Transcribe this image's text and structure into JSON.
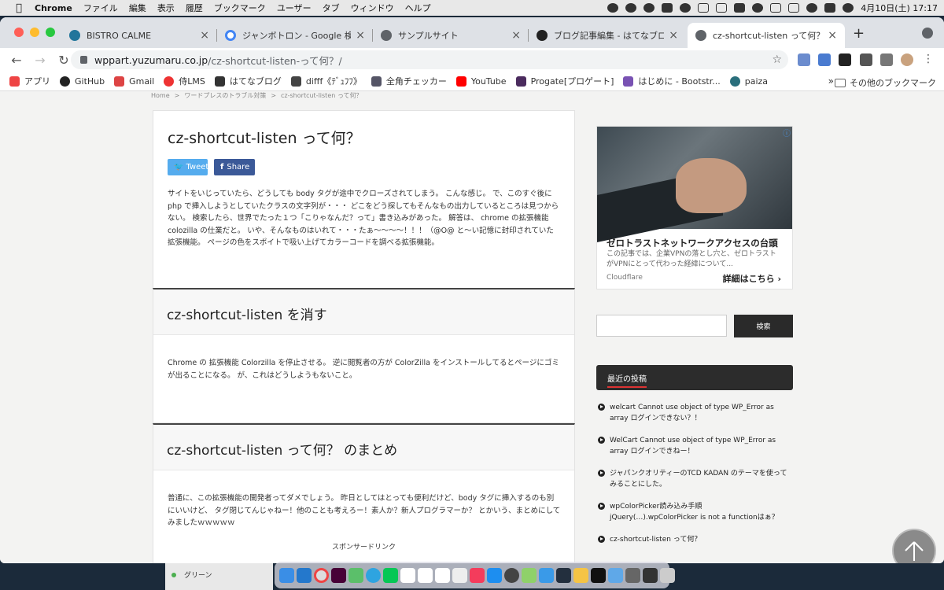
{
  "menubar": {
    "app": "Chrome",
    "items": [
      "ファイル",
      "編集",
      "表示",
      "履歴",
      "ブックマーク",
      "ユーザー",
      "タブ",
      "ウィンドウ",
      "ヘルプ"
    ],
    "clock": "4月10日(土)  17:17"
  },
  "tabs": [
    {
      "title": "BISTRO CALME"
    },
    {
      "title": "ジャンボトロン - Google 検索"
    },
    {
      "title": "サンプルサイト"
    },
    {
      "title": "ブログ記事編集 - はてなブログ"
    },
    {
      "title": "cz-shortcut-listen って何？ | ワ"
    }
  ],
  "address": {
    "host": "wppart.yuzumaru.co.jp",
    "path": "/cz-shortcut-listen-って何？/"
  },
  "bookmarks": {
    "items": [
      "アプリ",
      "GitHub",
      "Gmail",
      "侍LMS",
      "はてなブログ",
      "difff《ﾃﾞｭﾌﾌ》",
      "全角チェッカー",
      "YouTube",
      "Progate[プロゲート]",
      "はじめに - Bootstr...",
      "paiza"
    ],
    "other": "その他のブックマーク",
    "more": "»"
  },
  "breadcrumb": {
    "items": [
      "Home",
      "ワードプレスのトラブル対策",
      "cz-shortcut-listen って何？"
    ],
    "sep": ">"
  },
  "article": {
    "title": "cz-shortcut-listen って何？",
    "tweet": "Tweet",
    "share": "Share",
    "intro": "サイトをいじっていたら、どうしても body タグが途中でクローズされてしまう。 こんな感じ。 で、このすぐ後に php で挿入しようとしていたクラスの文字列が・・・ どこをどう探してもそんなもの出力しているところは見つからない。 検索したら、世界でたった１つ「こりゃなんだ？って」書き込みがあった。 解答は、 chrome の拡張機能 colozilla の仕業だと。 いや、そんなものはいれて・・・たぁ〜〜〜〜！！！（@O@ と〜い記憶に封印されていた拡張機能。 ページの色をスポイトで吸い上げてカラーコードを調べる拡張機能。",
    "section2_title": "cz-shortcut-listen を消す",
    "section2_text": "Chrome の 拡張機能 Colorzilla を停止させる。 逆に閲覧者の方が ColorZilla をインストールしてるとページにゴミが出ることになる。 が、これはどうしようもないこと。",
    "section3_title": "cz-shortcut-listen って何？ のまとめ",
    "section3_text": "普通に、この拡張機能の開発者ってダメでしょう。 昨日としてはとっても便利だけど、body タグに挿入するのも別にいいけど、 タグ閉じてんじゃねー！他のことも考えろー！素人か？新人プログラマーか？ とかいう、まとめにしてみましたｗｗｗｗｗ",
    "sponsor": "スポンサードリンク"
  },
  "ad": {
    "title": "ゼロトラストネットワークアクセスの台頭",
    "desc": "この記事では、企業VPNの落とし穴と、ゼロトラストがVPNにとって代わった経緯について...",
    "source": "Cloudflare",
    "more": "詳細はこちら",
    "info": "ⓘ"
  },
  "search": {
    "button": "検索",
    "placeholder": ""
  },
  "recent": {
    "heading": "最近の投稿",
    "posts": [
      "welcart Cannot use object of type WP_Error as array ログインできない？！",
      "WelCart Cannot use object of type WP_Error as array ログインできねー！",
      "ジャパンクオリティーのTCD KADAN のテーマを使ってみることにした。",
      "wpColorPicker読み込み手順 jQuery(…).wpColorPicker is not a functionはぁ？",
      "cz-shortcut-listen って何？"
    ]
  },
  "background_window": {
    "item": "グリーン"
  }
}
